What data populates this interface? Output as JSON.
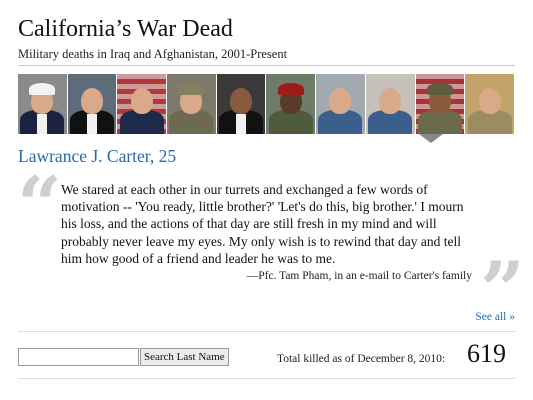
{
  "header": {
    "title": "California’s War Dead",
    "subtitle": "Military deaths in Iraq and Afghanistan, 2001-Present"
  },
  "portraits": [
    {
      "uniform": "dress-blues-red-trim",
      "bg": "#8a8a8a"
    },
    {
      "uniform": "tuxedo",
      "bg": "#5d6b7a"
    },
    {
      "uniform": "dress-blues-flag",
      "bg": "#b03a3a"
    },
    {
      "uniform": "combat-helmet",
      "bg": "#7d7a6c"
    },
    {
      "uniform": "tuxedo",
      "bg": "#3a3a3a"
    },
    {
      "uniform": "red-beret",
      "bg": "#6f7b69"
    },
    {
      "uniform": "civilian",
      "bg": "#a3a9b0"
    },
    {
      "uniform": "civilian",
      "bg": "#c6c1bb"
    },
    {
      "uniform": "camouflage-flag",
      "bg": "#a63434",
      "selected": true
    },
    {
      "uniform": "desert-camouflage",
      "bg": "#c2a46a"
    }
  ],
  "profile": {
    "name": "Lawrance J. Carter, 25",
    "quote": "We stared at each other in our turrets and exchanged a few words of motivation -- 'You ready, little brother?' 'Let's do this, big brother.' I mourn his loss, and the actions of that day are still fresh in my mind and will probably never leave my eyes. My only wish is to rewind that day and tell him how good of a friend and leader he was to me.",
    "attribution": "—Pfc. Tam Pham, in an e-mail to Carter's family",
    "quote_open_glyph": "“",
    "quote_close_glyph": "”"
  },
  "links": {
    "see_all": "See all »"
  },
  "search": {
    "value": "",
    "button_label": "Search Last Name"
  },
  "totals": {
    "label": "Total killed as of December 8, 2010:",
    "count": "619"
  },
  "colors": {
    "link": "#2b6aa6",
    "quote_glyph": "#cfcfcf"
  }
}
